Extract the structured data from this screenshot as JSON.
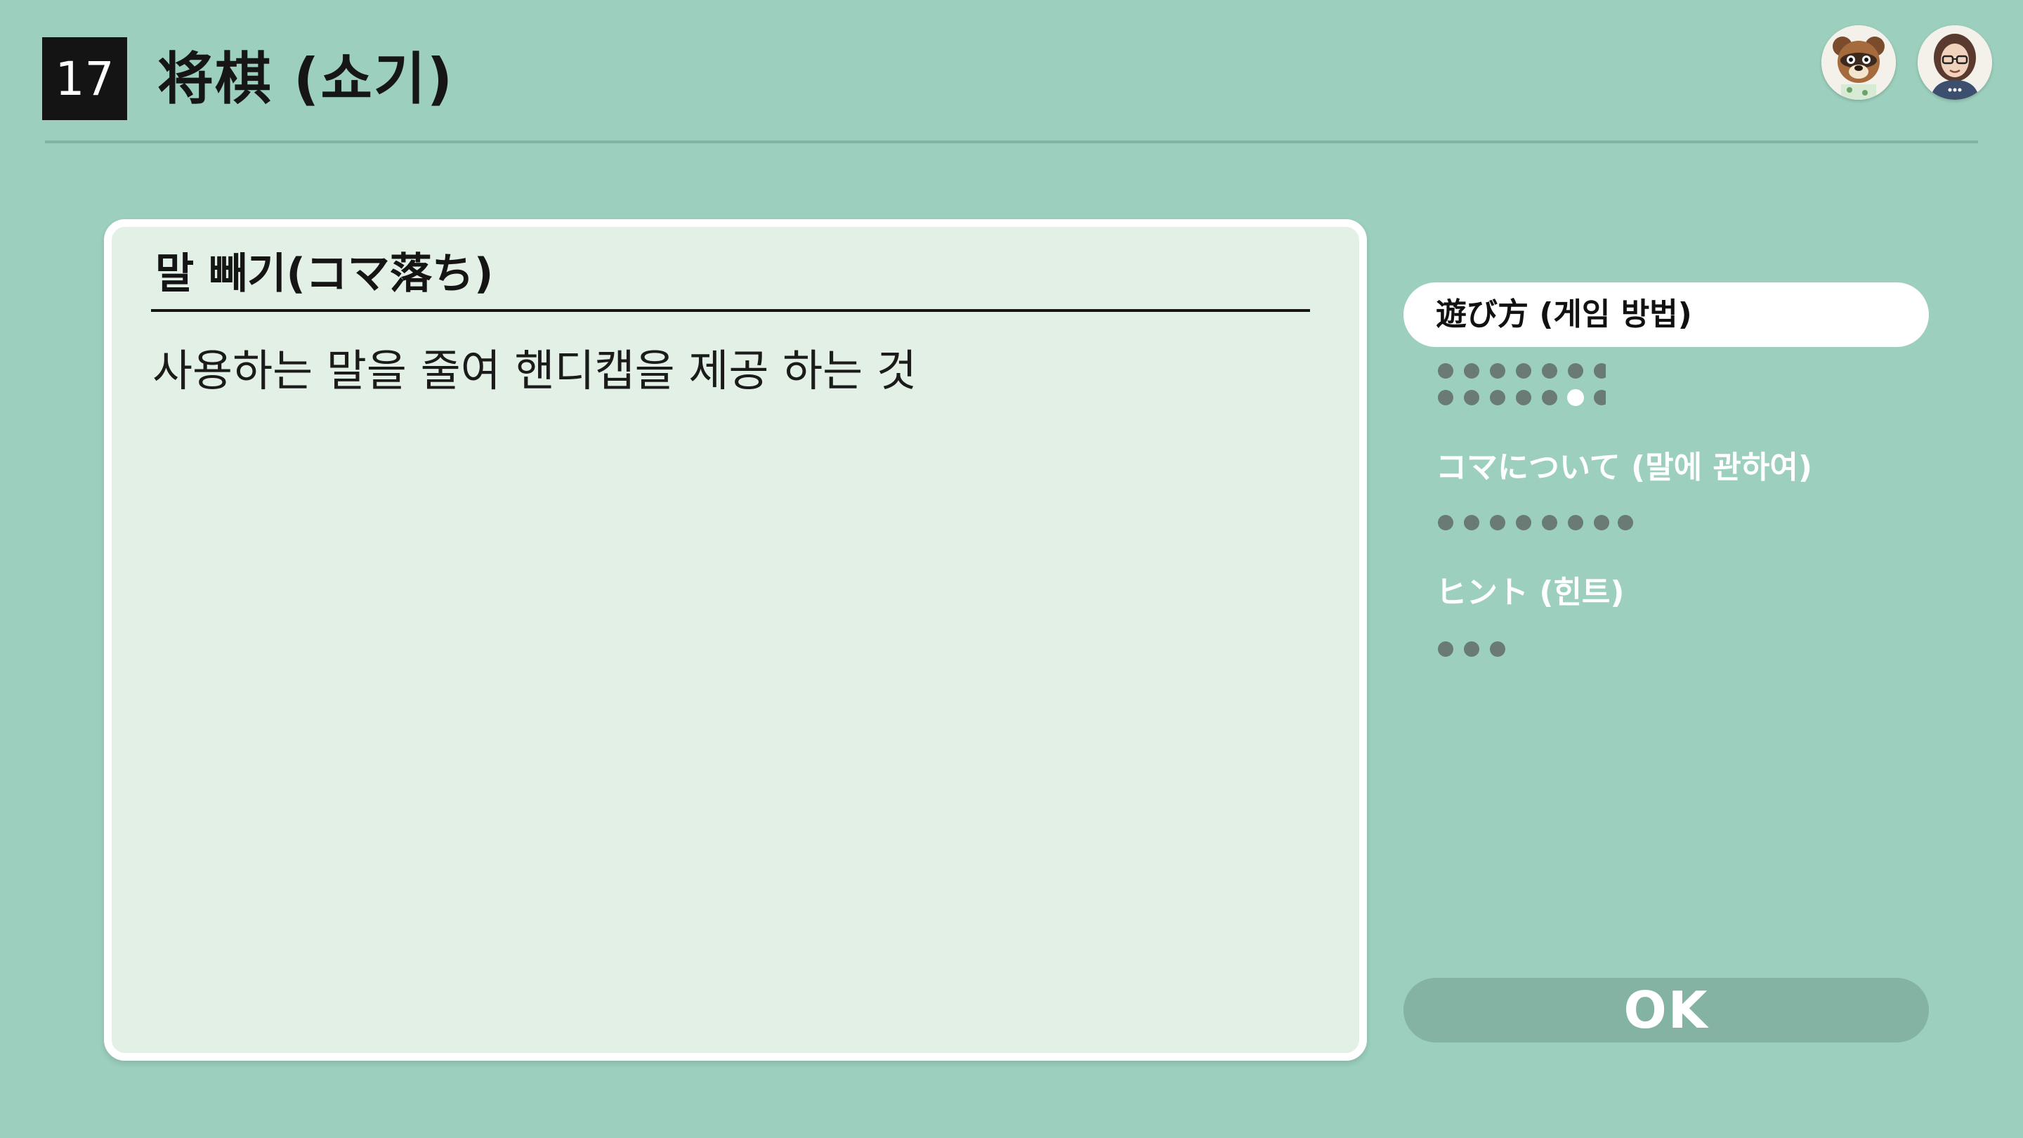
{
  "header": {
    "game_number": "17",
    "title": "将棋 (쇼기)",
    "avatars": [
      {
        "icon": "raccoon-character-avatar-icon"
      },
      {
        "icon": "woman-with-glasses-avatar-icon"
      }
    ]
  },
  "panel": {
    "title": "말 빼기(コマ落ち)",
    "body": "사용하는 말을 줄여 핸디캡을 제공 하는 것"
  },
  "sidebar": {
    "items": [
      {
        "label": "遊び方 (게임 방법)",
        "selected": true,
        "pages": 14,
        "current_page": 13
      },
      {
        "label": "コマについて (말에 관하여)",
        "selected": false,
        "pages": 8
      },
      {
        "label": "ヒント (힌트)",
        "selected": false,
        "pages": 3
      }
    ]
  },
  "ok_button": {
    "label": "OK"
  },
  "colors": {
    "background": "#9ccfbd",
    "panel": "#e3f0e6",
    "dot": "#6a7a74",
    "dot_active": "#ffffff",
    "ok_button": "#84b3a3"
  }
}
